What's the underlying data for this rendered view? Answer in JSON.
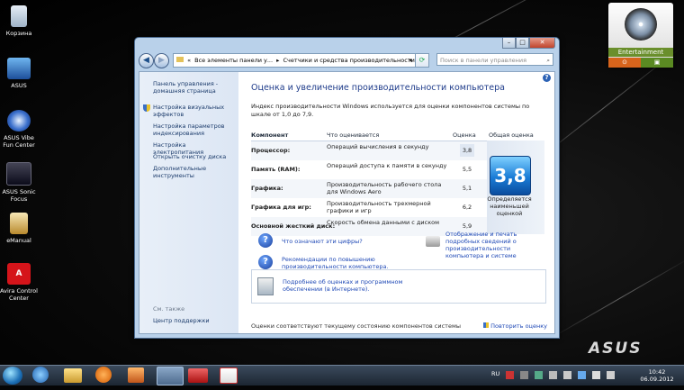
{
  "desktop": {
    "icons": [
      {
        "label": "Корзина"
      },
      {
        "label": "ASUS"
      },
      {
        "label": "ASUS Vibe Fun Center"
      },
      {
        "label": "ASUS Sonic Focus"
      },
      {
        "label": "eManual"
      },
      {
        "label": "Avira Control Center"
      }
    ],
    "brand": "ASUS",
    "gadget": {
      "title": "Entertainment",
      "btn_left": "⊙",
      "btn_right": "▣"
    }
  },
  "window": {
    "address": {
      "prefix": "«",
      "segment1": "Все элементы панели у...",
      "sep": "▸",
      "segment2": "Счетчики и средства производительности",
      "dropdown": "▾"
    },
    "search_placeholder": "Поиск в панели управления",
    "caption": {
      "min": "–",
      "max": "□",
      "close": "✕"
    },
    "sidebar": {
      "home": "Панель управления - домашняя страница",
      "links": [
        "Настройка визуальных эффектов",
        "Настройка параметров индексирования",
        "Настройка электропитания",
        "Открыть очистку диска",
        "Дополнительные инструменты"
      ],
      "see_also": "См. также",
      "support": "Центр поддержки"
    },
    "main": {
      "title": "Оценка и увеличение производительности компьютера",
      "intro": "Индекс производительности Windows используется для оценки компонентов системы по шкале от 1,0 до 7,9.",
      "headers": {
        "component": "Компонент",
        "what": "Что оценивается",
        "score": "Оценка",
        "overall": "Общая оценка"
      },
      "rows": [
        {
          "component": "Процессор:",
          "what": "Операций вычисления в секунду",
          "score": "3,8"
        },
        {
          "component": "Память (RAM):",
          "what": "Операций доступа к памяти в секунду",
          "score": "5,5"
        },
        {
          "component": "Графика:",
          "what": "Производительность рабочего стола для Windows Aero",
          "score": "5,1"
        },
        {
          "component": "Графика для игр:",
          "what": "Производительность трехмерной графики и игр",
          "score": "6,2"
        },
        {
          "component": "Основной жесткий диск:",
          "what": "Скорость обмена данными с диском",
          "score": "5,9"
        }
      ],
      "base_score": "3,8",
      "base_caption": "Определяется наименьшей оценкой",
      "links": {
        "what_numbers": "Что означают эти цифры?",
        "print": "Отображение и печать подробных сведений о производительности компьютера и системе",
        "tips": "Рекомендации по повышению производительности компьютера.",
        "online": "Подробнее об оценках и программном обеспечении (в Интернете)."
      },
      "footer_status": "Оценки соответствуют текущему состоянию компонентов системы",
      "rerun": "Повторить оценку"
    }
  },
  "taskbar": {
    "lang": "RU",
    "time": "10:42",
    "date": "06.09.2012"
  }
}
